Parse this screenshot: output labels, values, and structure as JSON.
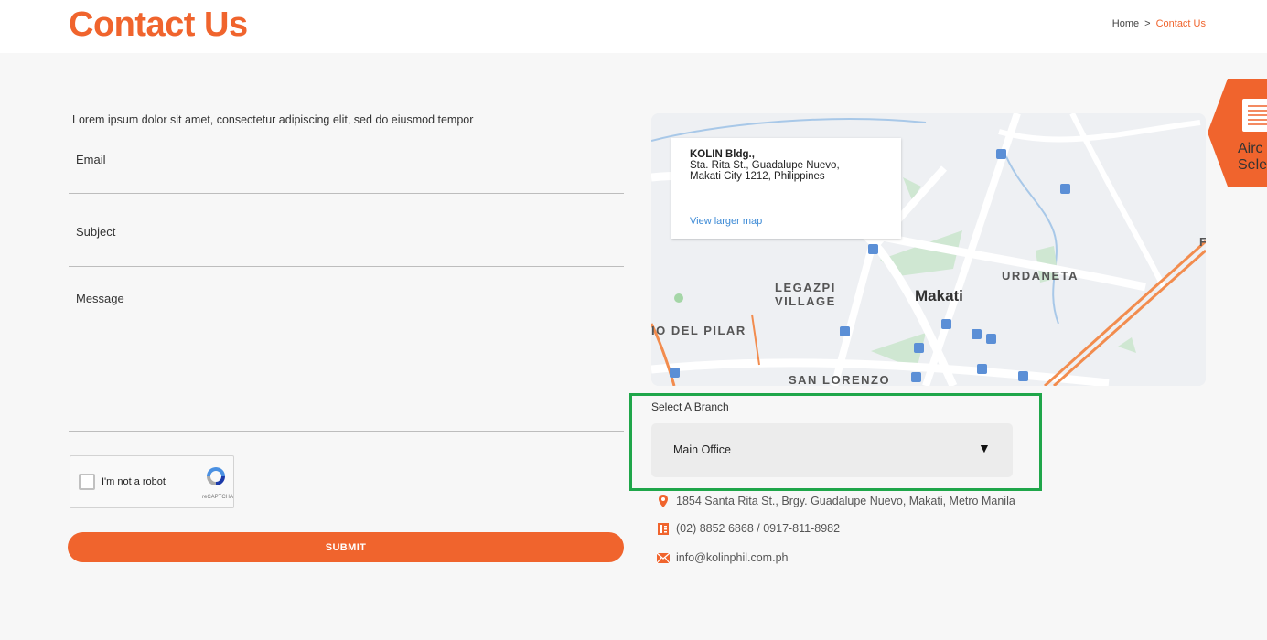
{
  "header": {
    "title": "Contact Us"
  },
  "breadcrumb": {
    "home": "Home",
    "separator": ">",
    "current": "Contact Us"
  },
  "form": {
    "intro": "Lorem ipsum dolor sit amet, consectetur adipiscing elit, sed do eiusmod tempor",
    "email_label": "Email",
    "subject_label": "Subject",
    "message_label": "Message",
    "recaptcha_text": "I'm not a robot",
    "recaptcha_brand": "reCAPTCHA",
    "submit_label": "SUBMIT"
  },
  "map": {
    "place_name": "KOLIN Bldg.,",
    "address_line1": "Sta. Rita St., Guadalupe Nuevo,",
    "address_line2": "Makati City 1212, Philippines",
    "view_larger": "View larger map",
    "labels": {
      "legazpi1": "LEGAZPI",
      "legazpi2": "VILLAGE",
      "makati": "Makati",
      "urdaneta": "URDANETA",
      "delpilar": "IO DEL PILAR",
      "sanlorenzo": "SAN LORENZO",
      "edge": "F"
    }
  },
  "branch": {
    "label": "Select A Branch",
    "selected": "Main Office",
    "caret": "▼"
  },
  "contact": {
    "address": "1854 Santa Rita St., Brgy. Guadalupe Nuevo, Makati, Metro Manila",
    "phone": "(02) 8852 6868 / 0917-811-8982",
    "email": "info@kolinphil.com.ph"
  },
  "floating_tab": {
    "line1": "Airc",
    "line2": "Selec"
  },
  "colors": {
    "accent": "#f0642d",
    "highlight": "#1fa64a",
    "link": "#3c8ad6"
  }
}
